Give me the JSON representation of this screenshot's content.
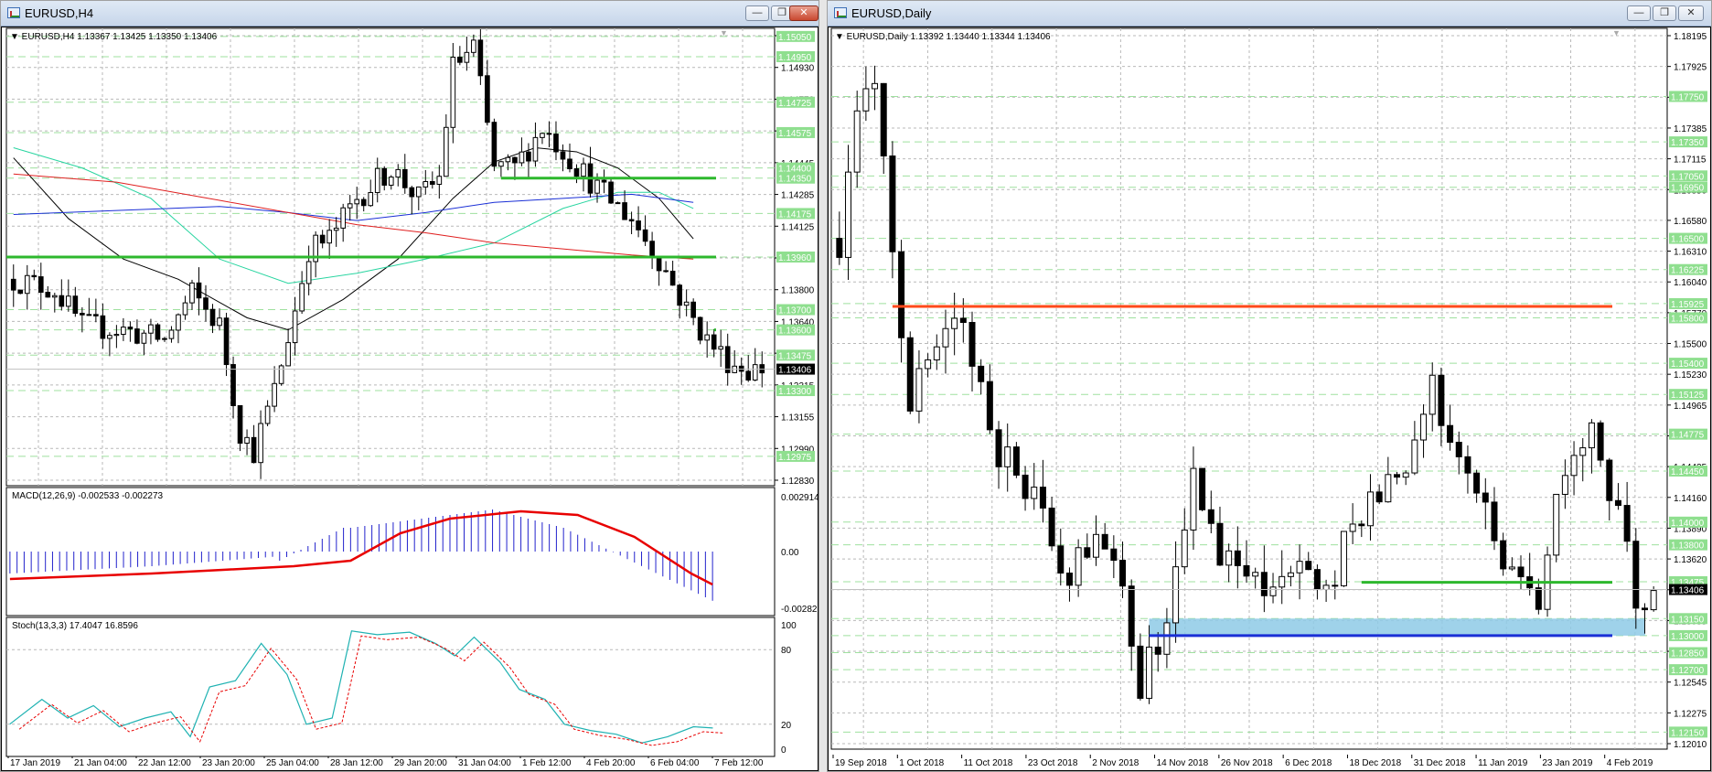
{
  "windows": {
    "h4": {
      "title": "EURUSD,H4"
    },
    "daily": {
      "title": "EURUSD,Daily"
    }
  },
  "buttons": {
    "minimize": "—",
    "restore": "❐",
    "close": "✕"
  },
  "colors": {
    "bull_candle": "#ffffff",
    "bear_candle": "#000000",
    "green_level": "#2db82d",
    "red_level": "#ff4a1a",
    "blue_level": "#1a2fd6",
    "support_zone": "#8ecae6",
    "grid_dash": "#b9b9b9",
    "level_dash": "#9fe09f",
    "price_tag_bg": "#8fdf8f",
    "current_price_tag": "#000000",
    "macd_hist": "#2222cc",
    "macd_signal": "#e80000",
    "stoch_main": "#1fb2b2",
    "stoch_signal": "#e80000",
    "ma_black": "#000000",
    "ma_blue": "#1a2fd6",
    "ma_cyan": "#28d5a0",
    "ma_red": "#e02020"
  },
  "chart_data": [
    {
      "id": "h4",
      "type": "candlestick",
      "symbol_info": "EURUSD,H4  1.13367 1.13425 1.13350 1.13406",
      "current_price": "1.13406",
      "ylim": [
        1.1283,
        1.1509
      ],
      "y_ticks": [
        "1.15090",
        "1.14930",
        "1.14770",
        "1.14605",
        "1.14445",
        "1.14285",
        "1.14125",
        "1.13960",
        "1.13800",
        "1.13640",
        "1.13475",
        "1.13315",
        "1.13155",
        "1.12990",
        "1.12830"
      ],
      "level_tags": [
        "1.15050",
        "1.14950",
        "1.14725",
        "1.14575",
        "1.14400",
        "1.14350",
        "1.14175",
        "1.13960",
        "1.13700",
        "1.13600",
        "1.13475",
        "1.13300",
        "1.12975"
      ],
      "x_labels": [
        "17 Jan 2019",
        "21 Jan 04:00",
        "22 Jan 12:00",
        "23 Jan 20:00",
        "25 Jan 04:00",
        "28 Jan 12:00",
        "29 Jan 20:00",
        "31 Jan 04:00",
        "1 Feb 12:00",
        "4 Feb 20:00",
        "6 Feb 04:00",
        "7 Feb 12:00"
      ],
      "horizontal_lines": [
        {
          "price": 1.1435,
          "from_index": 71,
          "color": "green"
        },
        {
          "price": 1.1396,
          "from_index": 0,
          "color": "green"
        },
        {
          "price": 1.136,
          "from_index": 102,
          "color": "green"
        }
      ],
      "macd": {
        "label": "MACD(12,26,9) -0.002533 -0.002273",
        "y_ticks": [
          "0.002914",
          "0.00",
          "-0.002828"
        ],
        "ylim": [
          -0.003,
          0.003
        ]
      },
      "stochastic": {
        "label": "Stoch(13,3,3) 17.4047 16.8596",
        "y_ticks": [
          "100",
          "80",
          "20",
          "0"
        ],
        "ylim": [
          0,
          100
        ]
      }
    },
    {
      "id": "daily",
      "type": "candlestick",
      "symbol_info": "EURUSD,Daily  1.13392 1.13440 1.13344 1.13406",
      "current_price": "1.13406",
      "ylim": [
        1.12,
        1.1835
      ],
      "y_ticks": [
        "1.18195",
        "1.17925",
        "1.17655",
        "1.17385",
        "1.17115",
        "1.16850",
        "1.16580",
        "1.16310",
        "1.16040",
        "1.15770",
        "1.15500",
        "1.15230",
        "1.14965",
        "1.14695",
        "1.14425",
        "1.14160",
        "1.13890",
        "1.13620",
        "1.13350",
        "1.13085",
        "1.12815",
        "1.12545",
        "1.12275",
        "1.12010"
      ],
      "level_tags": [
        "1.17750",
        "1.17350",
        "1.17050",
        "1.16950",
        "1.16500",
        "1.16225",
        "1.15925",
        "1.15800",
        "1.15400",
        "1.15125",
        "1.14775",
        "1.14450",
        "1.14000",
        "1.13800",
        "1.13475",
        "1.13150",
        "1.13000",
        "1.12850",
        "1.12700",
        "1.12150"
      ],
      "x_labels": [
        "19 Sep 2018",
        "1 Oct 2018",
        "11 Oct 2018",
        "23 Oct 2018",
        "2 Nov 2018",
        "14 Nov 2018",
        "26 Nov 2018",
        "6 Dec 2018",
        "18 Dec 2018",
        "31 Dec 2018",
        "11 Jan 2019",
        "23 Jan 2019",
        "4 Feb 2019"
      ],
      "horizontal_lines": [
        {
          "price": 1.159,
          "from_index": 6,
          "color": "red"
        },
        {
          "price": 1.1347,
          "from_index": 59,
          "color": "green"
        },
        {
          "price": 1.13,
          "from_index": 35,
          "color": "blue"
        }
      ],
      "support_zone": {
        "from_index": 35,
        "low": 1.13,
        "high": 1.1315
      }
    }
  ]
}
